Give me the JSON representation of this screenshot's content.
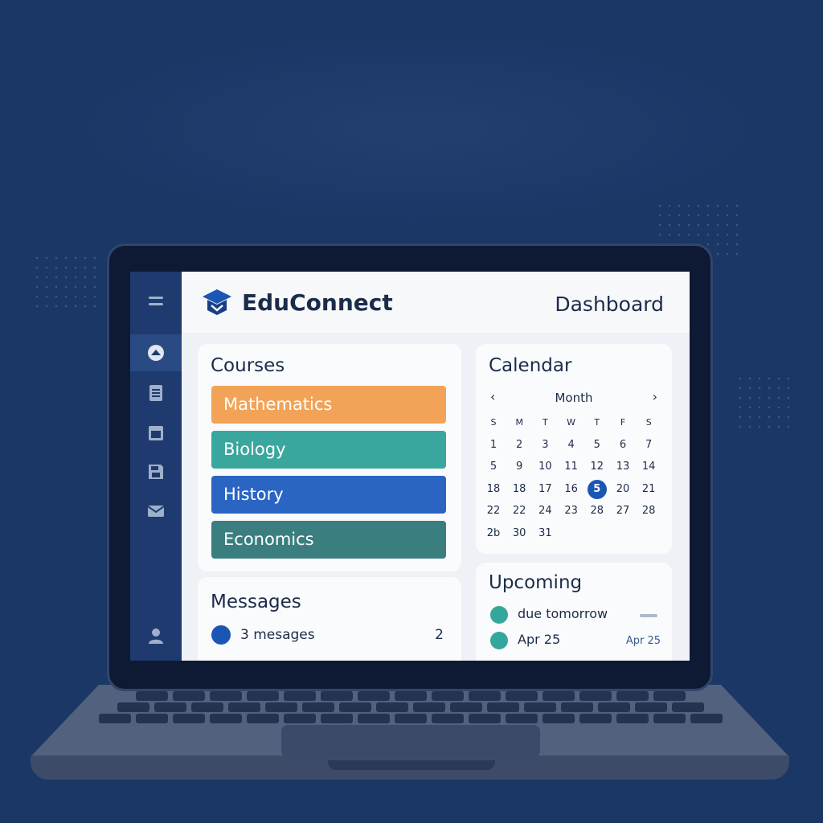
{
  "app": {
    "title": "EduConnect",
    "page_title": "Dashboard"
  },
  "colors": {
    "background": "#1b3766",
    "sidebar": "#1e3a6e",
    "accent": "#1b56b4",
    "teal": "#33a79b"
  },
  "sidebar": {
    "items": [
      {
        "icon": "menu-icon"
      },
      {
        "icon": "home-icon",
        "active": true
      },
      {
        "icon": "document-icon"
      },
      {
        "icon": "calendar-icon"
      },
      {
        "icon": "save-icon"
      },
      {
        "icon": "mail-icon"
      },
      {
        "icon": "user-icon"
      }
    ]
  },
  "courses": {
    "title": "Courses",
    "items": [
      {
        "label": "Mathematics",
        "color": "#f2a357"
      },
      {
        "label": "Biology",
        "color": "#3aa79f"
      },
      {
        "label": "History",
        "color": "#2a65c3"
      },
      {
        "label": "Economics",
        "color": "#3a7e80"
      }
    ]
  },
  "calendar": {
    "title": "Calendar",
    "prev": "‹",
    "next": "›",
    "month_label": "Month",
    "weekdays": [
      "S",
      "M",
      "T",
      "W",
      "T",
      "F",
      "S"
    ],
    "weeks": [
      [
        "1",
        "2",
        "3",
        "4",
        "5",
        "6",
        "7"
      ],
      [
        "5",
        "9",
        "10",
        "11",
        "12",
        "13",
        "14"
      ],
      [
        "18",
        "18",
        "17",
        "16",
        "5",
        "20",
        "21"
      ],
      [
        "22",
        "22",
        "24",
        "23",
        "28",
        "27",
        "28"
      ],
      [
        "2b",
        "30",
        "31"
      ]
    ],
    "highlight": {
      "week": 2,
      "day": 4
    }
  },
  "messages": {
    "title": "Messages",
    "text": "3 mesages",
    "count": "2"
  },
  "upcoming": {
    "title": "Upcoming",
    "items": [
      {
        "text": "due tomorrow"
      },
      {
        "text": "Apr 25",
        "date": "Apr 25"
      }
    ]
  }
}
